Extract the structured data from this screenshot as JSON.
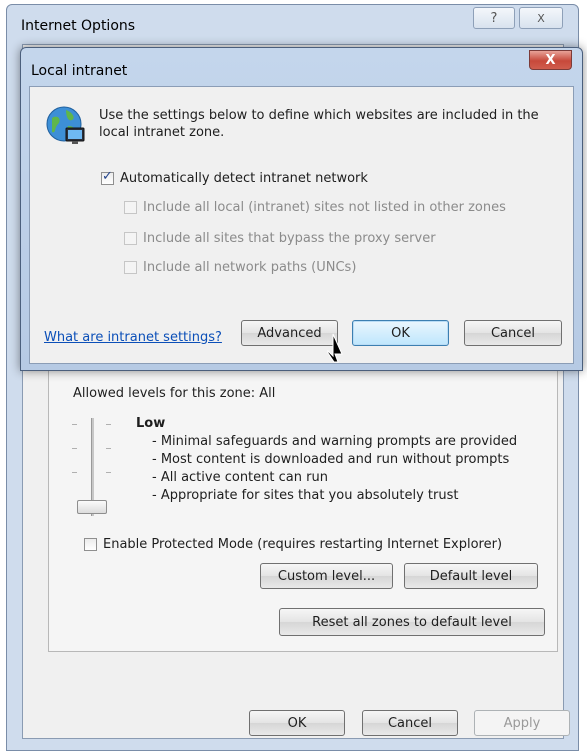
{
  "outer_window": {
    "title": "Internet Options",
    "help_label": "?",
    "close_label": "X",
    "allowed_levels": "Allowed levels for this zone: All",
    "level_name": "Low",
    "level_description": [
      "- Minimal safeguards and warning prompts are provided",
      "- Most content is downloaded and run without prompts",
      "- All active content can run",
      "- Appropriate for sites that you absolutely trust"
    ],
    "protected_mode": {
      "label": "Enable Protected Mode (requires restarting Internet Explorer)",
      "checked": false
    },
    "custom_level_label": "Custom level...",
    "default_level_label": "Default level",
    "reset_all_label": "Reset all zones to default level",
    "ok_label": "OK",
    "cancel_label": "Cancel",
    "apply_label": "Apply"
  },
  "dialog": {
    "title": "Local intranet",
    "close_label": "X",
    "intro": "Use the settings below to define which websites are included in the local intranet zone.",
    "auto_detect": {
      "label": "Automatically detect intranet network",
      "checked": true
    },
    "options": [
      {
        "label": "Include all local (intranet) sites not listed in other zones",
        "checked": false,
        "enabled": false
      },
      {
        "label": "Include all sites that bypass the proxy server",
        "checked": false,
        "enabled": false
      },
      {
        "label": "Include all network paths (UNCs)",
        "checked": false,
        "enabled": false
      }
    ],
    "help_link": "What are intranet settings?",
    "advanced_label": "Advanced",
    "ok_label": "OK",
    "cancel_label": "Cancel"
  },
  "icons": {
    "globe": "intranet-globe-icon",
    "cursor": "mouse-pointer-icon"
  },
  "colors": {
    "link": "#0b4fb8",
    "title_bar": "#c4d6ec",
    "close_button": "#c7493b",
    "focus_button": "#3c7fb1"
  }
}
